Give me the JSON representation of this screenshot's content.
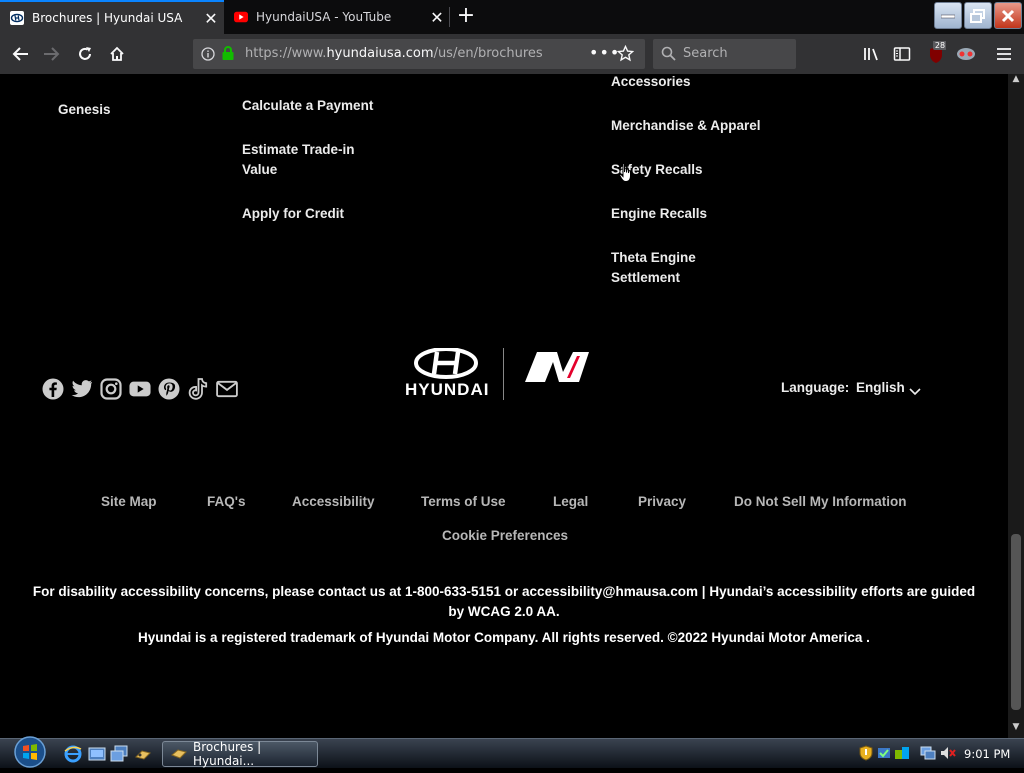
{
  "browser": {
    "tabs": [
      {
        "title": "Brochures | Hyundai USA",
        "active": true
      },
      {
        "title": "HyundaiUSA - YouTube",
        "active": false
      }
    ],
    "url": {
      "prefix": "https://www.",
      "domain": "hyundaiusa.com",
      "path": "/us/en/brochures"
    },
    "search_placeholder": "Search",
    "badge_count": "28"
  },
  "footer": {
    "col1": [
      "Genesis"
    ],
    "col2": [
      "Calculate a Payment",
      "Estimate Trade-in Value",
      "Apply for Credit"
    ],
    "col3": [
      "Accessories",
      "Merchandise & Apparel",
      "Safety Recalls",
      "Engine Recalls",
      "Theta Engine Settlement"
    ],
    "social_icons": [
      "facebook-icon",
      "twitter-icon",
      "instagram-icon",
      "youtube-icon",
      "pinterest-icon",
      "tiktok-icon",
      "email-icon"
    ],
    "brand_text": "HYUNDAI",
    "language_label": "Language:",
    "language_value": "English",
    "legal_links": [
      "Site Map",
      "FAQ's",
      "Accessibility",
      "Terms of Use",
      "Legal",
      "Privacy",
      "Do Not Sell My Information"
    ],
    "cookie_link": "Cookie Preferences",
    "disclaimer": "For disability accessibility concerns, please contact us at 1-800-633-5151 or accessibility@hmausa.com |  Hyundai’s accessibility efforts are guided by WCAG 2.0 AA.",
    "trademark": "Hyundai is a registered trademark of Hyundai Motor Company. All rights reserved. ©2022 Hyundai Motor America ."
  },
  "taskbar": {
    "window_label": "Brochures | Hyundai...",
    "clock": "9:01 PM"
  },
  "colors": {
    "accent_tab": "#0a84ff",
    "page_bg": "#000000",
    "n_red": "#e4002b"
  }
}
